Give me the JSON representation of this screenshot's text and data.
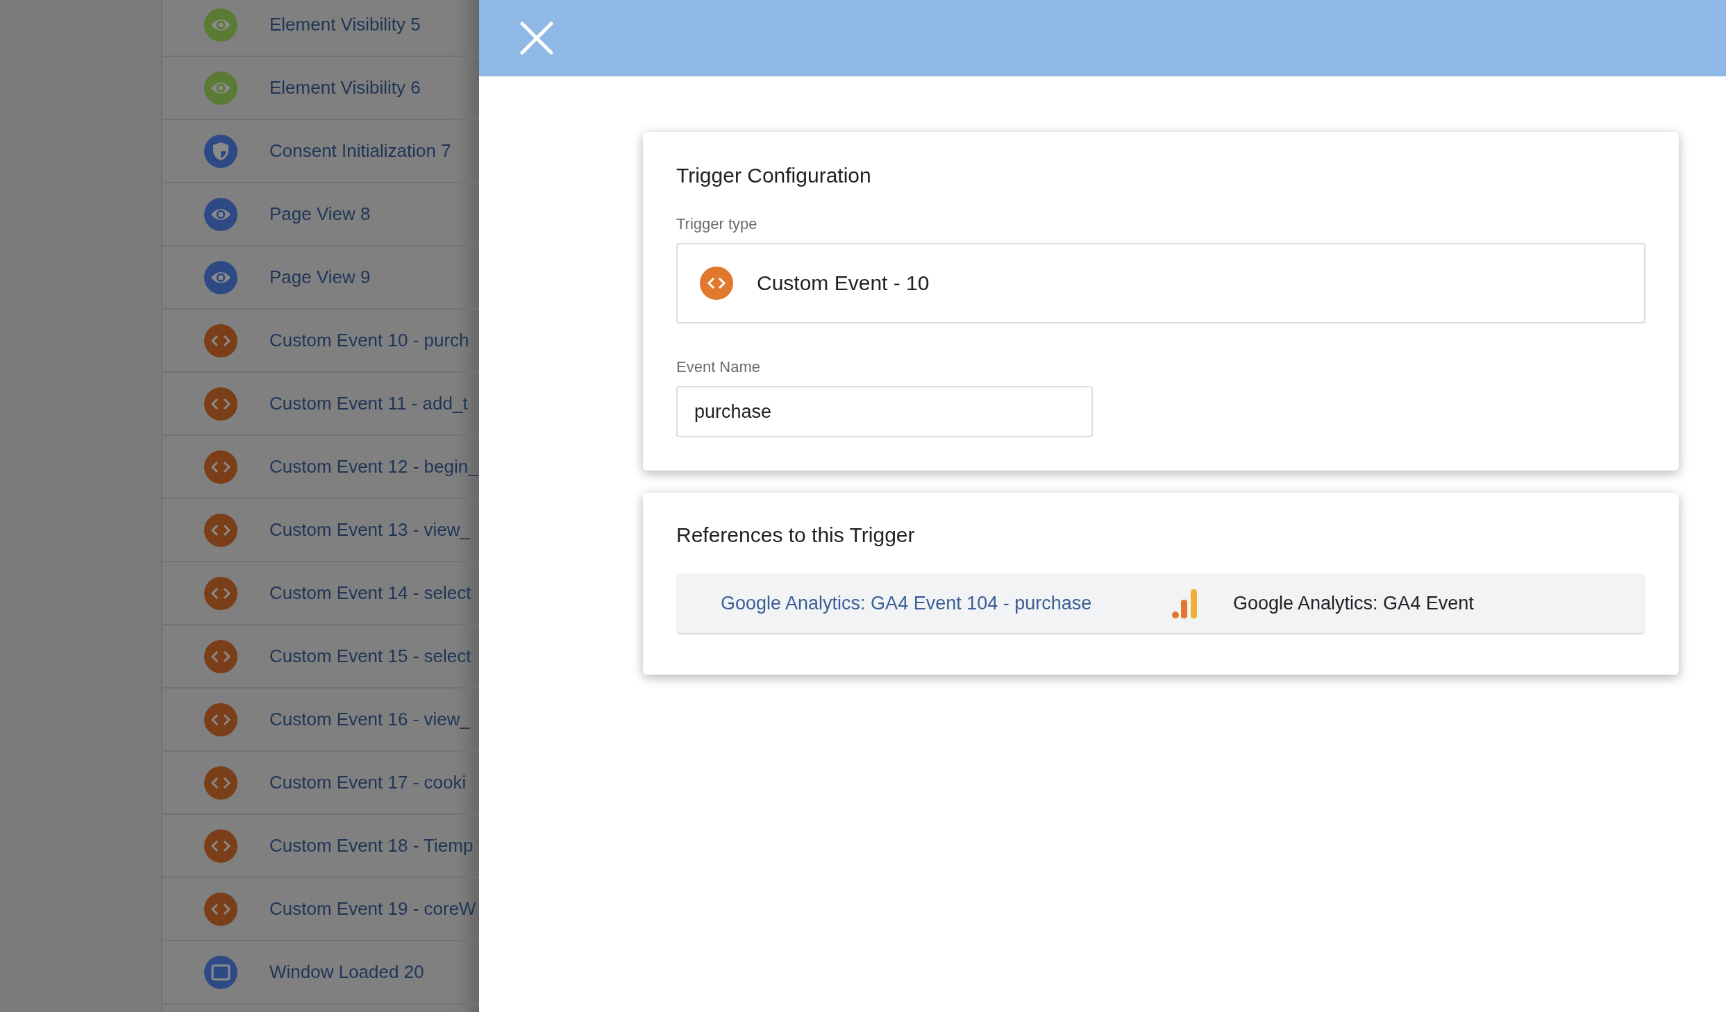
{
  "triggers": [
    {
      "label": "Element Visibility 5",
      "kind": "eye",
      "color": "#5b7a34"
    },
    {
      "label": "Element Visibility 6",
      "kind": "eye",
      "color": "#5b7a34"
    },
    {
      "label": "Consent Initialization 7",
      "kind": "shield",
      "color": "#2e4a85"
    },
    {
      "label": "Page View 8",
      "kind": "eye",
      "color": "#2e4a85"
    },
    {
      "label": "Page View 9",
      "kind": "eye",
      "color": "#2e4a85"
    },
    {
      "label": "Custom Event 10 - purch",
      "kind": "code",
      "color": "#7a3f19"
    },
    {
      "label": "Custom Event 11 - add_t",
      "kind": "code",
      "color": "#7a3f19"
    },
    {
      "label": "Custom Event 12 - begin_",
      "kind": "code",
      "color": "#7a3f19"
    },
    {
      "label": "Custom Event 13 - view_",
      "kind": "code",
      "color": "#7a3f19"
    },
    {
      "label": "Custom Event 14 - select",
      "kind": "code",
      "color": "#7a3f19"
    },
    {
      "label": "Custom Event 15 - select",
      "kind": "code",
      "color": "#7a3f19"
    },
    {
      "label": "Custom Event 16 - view_",
      "kind": "code",
      "color": "#7a3f19"
    },
    {
      "label": "Custom Event 17 - cooki",
      "kind": "code",
      "color": "#7a3f19"
    },
    {
      "label": "Custom Event 18 - Tiemp",
      "kind": "code",
      "color": "#7a3f19"
    },
    {
      "label": "Custom Event 19 - coreW",
      "kind": "code",
      "color": "#7a3f19"
    },
    {
      "label": "Window Loaded 20",
      "kind": "window",
      "color": "#2e4a85"
    }
  ],
  "configuration": {
    "title": "Trigger Configuration",
    "trigger_type_label": "Trigger type",
    "trigger_type": "Custom Event - 10",
    "event_name_label": "Event Name",
    "event_name": "purchase"
  },
  "references": {
    "title": "References to this Trigger",
    "items": [
      {
        "name": "Google Analytics: GA4 Event 104 - purchase",
        "type": "Google Analytics: GA4 Event"
      }
    ]
  }
}
